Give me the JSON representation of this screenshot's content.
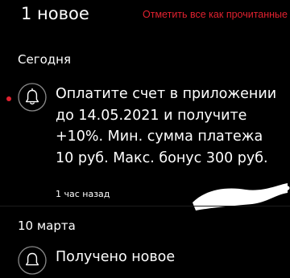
{
  "header": {
    "title": "1 новое",
    "mark_all_read": "Отметить все как прочитанные"
  },
  "sections": [
    {
      "title": "Сегодня",
      "notifications": [
        {
          "text": "Оплатите счет в приложении до 14.05.2021 и получите +10%. Мин. сумма платежа 10 руб. Макс. бонус 300 руб.",
          "time": "1 час назад",
          "unread": true,
          "icon": "bell-icon"
        }
      ]
    },
    {
      "title": "10 марта",
      "notifications": [
        {
          "text": "Получено новое",
          "icon": "bell-icon"
        }
      ]
    }
  ],
  "colors": {
    "accent": "#e0212f",
    "background": "#000000",
    "text": "#ffffff",
    "icon_border": "#8a8a8a"
  }
}
